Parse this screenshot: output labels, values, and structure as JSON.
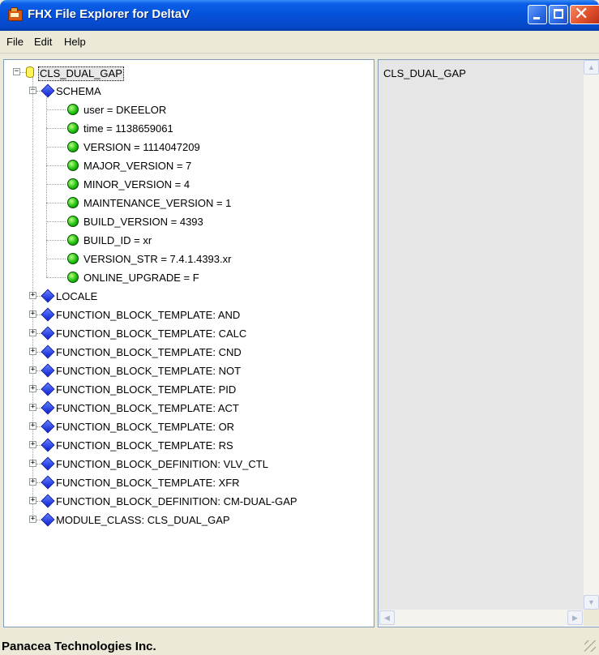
{
  "window": {
    "title": "FHX File Explorer for DeltaV",
    "controls": {
      "minimize": "minimize-icon",
      "maximize": "maximize-icon",
      "close": "close-icon"
    }
  },
  "menu": {
    "items": [
      {
        "label": "File"
      },
      {
        "label": "Edit"
      },
      {
        "label": "Help"
      }
    ]
  },
  "tree": {
    "root": {
      "label": "CLS_DUAL_GAP",
      "icon": "database-icon",
      "expanded": true,
      "selected": true
    },
    "schema": {
      "label": "SCHEMA",
      "icon": "diamond-icon",
      "expanded": true,
      "children": [
        {
          "label": "user = DKEELOR",
          "icon": "green-dot-icon"
        },
        {
          "label": "time = 1138659061",
          "icon": "green-dot-icon"
        },
        {
          "label": "VERSION = 1114047209",
          "icon": "green-dot-icon"
        },
        {
          "label": "MAJOR_VERSION = 7",
          "icon": "green-dot-icon"
        },
        {
          "label": "MINOR_VERSION = 4",
          "icon": "green-dot-icon"
        },
        {
          "label": "MAINTENANCE_VERSION = 1",
          "icon": "green-dot-icon"
        },
        {
          "label": "BUILD_VERSION = 4393",
          "icon": "green-dot-icon"
        },
        {
          "label": "BUILD_ID = xr",
          "icon": "green-dot-icon"
        },
        {
          "label": "VERSION_STR = 7.4.1.4393.xr",
          "icon": "green-dot-icon"
        },
        {
          "label": "ONLINE_UPGRADE = F",
          "icon": "green-dot-icon"
        }
      ]
    },
    "sections": [
      {
        "label": "LOCALE",
        "expanded": false
      },
      {
        "label": "FUNCTION_BLOCK_TEMPLATE: AND",
        "expanded": false
      },
      {
        "label": "FUNCTION_BLOCK_TEMPLATE: CALC",
        "expanded": false
      },
      {
        "label": "FUNCTION_BLOCK_TEMPLATE: CND",
        "expanded": false
      },
      {
        "label": "FUNCTION_BLOCK_TEMPLATE: NOT",
        "expanded": false
      },
      {
        "label": "FUNCTION_BLOCK_TEMPLATE: PID",
        "expanded": false
      },
      {
        "label": "FUNCTION_BLOCK_TEMPLATE: ACT",
        "expanded": false
      },
      {
        "label": "FUNCTION_BLOCK_TEMPLATE: OR",
        "expanded": false
      },
      {
        "label": "FUNCTION_BLOCK_TEMPLATE: RS",
        "expanded": false
      },
      {
        "label": "FUNCTION_BLOCK_DEFINITION: VLV_CTL",
        "expanded": false
      },
      {
        "label": "FUNCTION_BLOCK_TEMPLATE: XFR",
        "expanded": false
      },
      {
        "label": "FUNCTION_BLOCK_DEFINITION: CM-DUAL-GAP",
        "expanded": false
      },
      {
        "label": "MODULE_CLASS: CLS_DUAL_GAP",
        "expanded": false
      }
    ]
  },
  "detail_pane": {
    "text": "CLS_DUAL_GAP"
  },
  "status_bar": {
    "text": "Panacea Technologies Inc."
  },
  "colors": {
    "titlebar": "#0551d8",
    "close_button": "#e0502a",
    "face": "#ece9d8",
    "tree_bg": "#ffffff",
    "detail_bg": "#e6e6e6",
    "green_dot": "#20c010",
    "blue_diamond": "#1020d0",
    "db_yellow": "#fff45a"
  }
}
